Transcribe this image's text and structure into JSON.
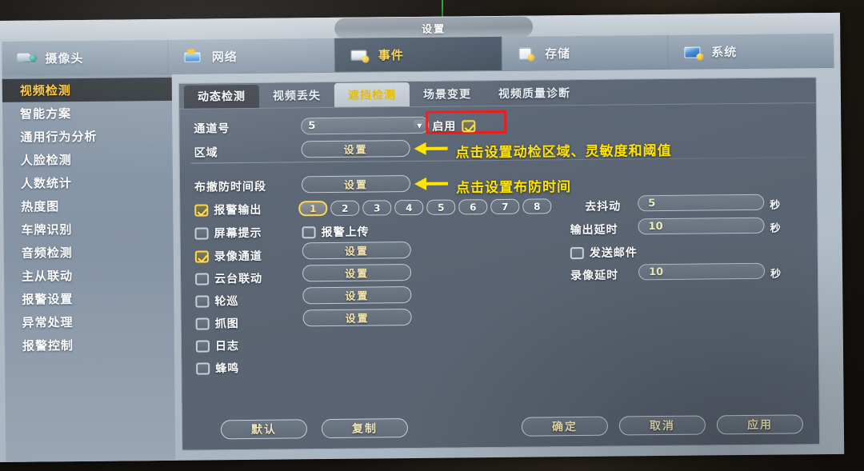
{
  "window": {
    "title": "设置"
  },
  "topnav": [
    {
      "label": "摄像头",
      "icon": "camera-icon",
      "active": false
    },
    {
      "label": "网络",
      "icon": "network-icon",
      "active": false
    },
    {
      "label": "事件",
      "icon": "event-icon",
      "active": true
    },
    {
      "label": "存储",
      "icon": "storage-icon",
      "active": false
    },
    {
      "label": "系统",
      "icon": "system-icon",
      "active": false
    }
  ],
  "sidebar": {
    "items": [
      {
        "label": "视频检测",
        "active": true
      },
      {
        "label": "智能方案",
        "active": false
      },
      {
        "label": "通用行为分析",
        "active": false
      },
      {
        "label": "人脸检测",
        "active": false
      },
      {
        "label": "人数统计",
        "active": false
      },
      {
        "label": "热度图",
        "active": false
      },
      {
        "label": "车牌识别",
        "active": false
      },
      {
        "label": "音频检测",
        "active": false
      },
      {
        "label": "主从联动",
        "active": false
      },
      {
        "label": "报警设置",
        "active": false
      },
      {
        "label": "异常处理",
        "active": false
      },
      {
        "label": "报警控制",
        "active": false
      }
    ]
  },
  "tabs": [
    {
      "label": "动态检测",
      "state": "active"
    },
    {
      "label": "视频丢失",
      "state": "normal"
    },
    {
      "label": "遮挡检测",
      "state": "highlight"
    },
    {
      "label": "场景变更",
      "state": "normal"
    },
    {
      "label": "视频质量诊断",
      "state": "normal"
    }
  ],
  "form": {
    "channel_label": "通道号",
    "channel_value": "5",
    "enable_label": "启用",
    "enable_checked": true,
    "area_label": "区域",
    "area_button": "设置",
    "schedule_label": "布撤防时间段",
    "schedule_button": "设置",
    "alarm_out_label": "报警输出",
    "alarm_out_checked": true,
    "alarm_out_numbers": [
      "1",
      "2",
      "3",
      "4",
      "5",
      "6",
      "7",
      "8"
    ],
    "alarm_out_selected": "1",
    "screen_tip_label": "屏幕提示",
    "screen_tip_checked": false,
    "alarm_upload_label": "报警上传",
    "alarm_upload_checked": false,
    "record_channel_label": "录像通道",
    "record_channel_checked": true,
    "record_channel_button": "设置",
    "ptz_label": "云台联动",
    "ptz_checked": false,
    "ptz_button": "设置",
    "tour_label": "轮巡",
    "tour_checked": false,
    "tour_button": "设置",
    "snapshot_label": "抓图",
    "snapshot_checked": false,
    "snapshot_button": "设置",
    "log_label": "日志",
    "log_checked": false,
    "buzzer_label": "蜂鸣",
    "buzzer_checked": false,
    "debounce_label": "去抖动",
    "debounce_value": "5",
    "debounce_unit": "秒",
    "output_delay_label": "输出延时",
    "output_delay_value": "10",
    "output_delay_unit": "秒",
    "send_mail_label": "发送邮件",
    "send_mail_checked": false,
    "record_delay_label": "录像延时",
    "record_delay_value": "10",
    "record_delay_unit": "秒"
  },
  "annotations": [
    {
      "text": "点击设置动检区域、灵敏度和阈值"
    },
    {
      "text": "点击设置布防时间"
    }
  ],
  "footer": {
    "default_label": "默认",
    "copy_label": "复制",
    "ok_label": "确定",
    "cancel_label": "取消",
    "apply_label": "应用"
  },
  "colors": {
    "accent_yellow": "#ffe400",
    "highlight_red": "#ef1c1c",
    "active_item_gold": "#ffc933",
    "panel_bg": "#5a6370"
  }
}
